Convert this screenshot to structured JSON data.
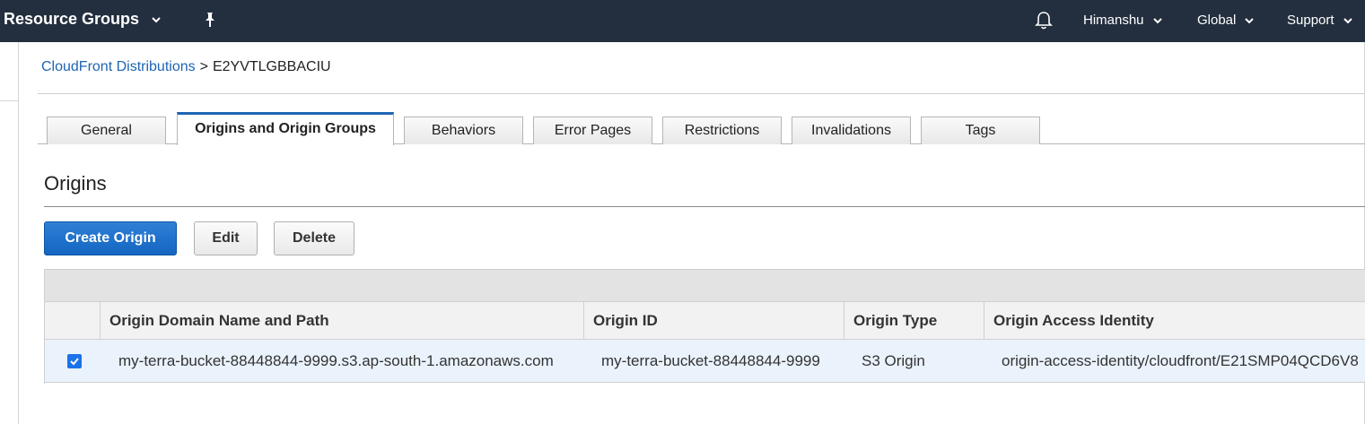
{
  "topbar": {
    "resource_groups": "Resource Groups",
    "user": "Himanshu",
    "region": "Global",
    "support": "Support",
    "bg_color": "#232f3e"
  },
  "breadcrumb": {
    "parent": "CloudFront Distributions",
    "separator": ">",
    "current": "E2YVTLGBBACIU"
  },
  "tabs": [
    {
      "label": "General"
    },
    {
      "label": "Origins and Origin Groups",
      "active": true
    },
    {
      "label": "Behaviors"
    },
    {
      "label": "Error Pages"
    },
    {
      "label": "Restrictions"
    },
    {
      "label": "Invalidations"
    },
    {
      "label": "Tags"
    }
  ],
  "section": {
    "title": "Origins"
  },
  "buttons": {
    "create": "Create Origin",
    "edit": "Edit",
    "delete": "Delete"
  },
  "table": {
    "columns": [
      "Origin Domain Name and Path",
      "Origin ID",
      "Origin Type",
      "Origin Access Identity"
    ],
    "rows": [
      {
        "selected": true,
        "domain": "my-terra-bucket-88448844-9999.s3.ap-south-1.amazonaws.com",
        "id": "my-terra-bucket-88448844-9999",
        "type": "S3 Origin",
        "oai": "origin-access-identity/cloudfront/E21SMP04QCD6V8"
      }
    ]
  },
  "colors": {
    "accent": "#1e64b4",
    "primary_button": "#1466c1",
    "selected_row": "#eaf3fc"
  }
}
